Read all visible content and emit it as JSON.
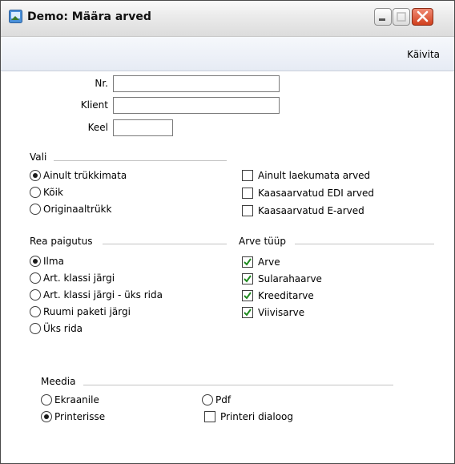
{
  "window": {
    "title": "Demo: Määra arved",
    "icon": "app-icon"
  },
  "toolbar": {
    "run_label": "Käivita"
  },
  "fields": {
    "nr": {
      "label": "Nr.",
      "value": ""
    },
    "client": {
      "label": "Klient",
      "value": ""
    },
    "language": {
      "label": "Keel",
      "value": ""
    }
  },
  "select_group": {
    "title": "Vali",
    "options": [
      {
        "label": "Ainult trükkimata",
        "checked": true
      },
      {
        "label": "Kõik",
        "checked": false
      },
      {
        "label": "Originaaltrükk",
        "checked": false
      }
    ],
    "checkboxes": [
      {
        "label": "Ainult laekumata arved",
        "checked": false
      },
      {
        "label": "Kaasaarvatud EDI arved",
        "checked": false
      },
      {
        "label": "Kaasaarvatud E-arved",
        "checked": false
      }
    ]
  },
  "row_layout": {
    "title": "Rea paigutus",
    "options": [
      {
        "label": "Ilma",
        "checked": true
      },
      {
        "label": "Art. klassi järgi",
        "checked": false
      },
      {
        "label": "Art. klassi järgi - üks rida",
        "checked": false
      },
      {
        "label": "Ruumi paketi järgi",
        "checked": false
      },
      {
        "label": "Üks rida",
        "checked": false
      }
    ]
  },
  "invoice_type": {
    "title": "Arve tüüp",
    "checkboxes": [
      {
        "label": "Arve",
        "checked": true
      },
      {
        "label": "Sularahaarve",
        "checked": true
      },
      {
        "label": "Kreeditarve",
        "checked": true
      },
      {
        "label": "Viivisarve",
        "checked": true
      }
    ]
  },
  "media": {
    "title": "Meedia",
    "options": [
      {
        "label": "Ekraanile",
        "checked": false
      },
      {
        "label": "Printerisse",
        "checked": true
      },
      {
        "label": "Pdf",
        "checked": false
      }
    ],
    "print_dialog": {
      "label": "Printeri dialoog",
      "checked": false
    }
  }
}
